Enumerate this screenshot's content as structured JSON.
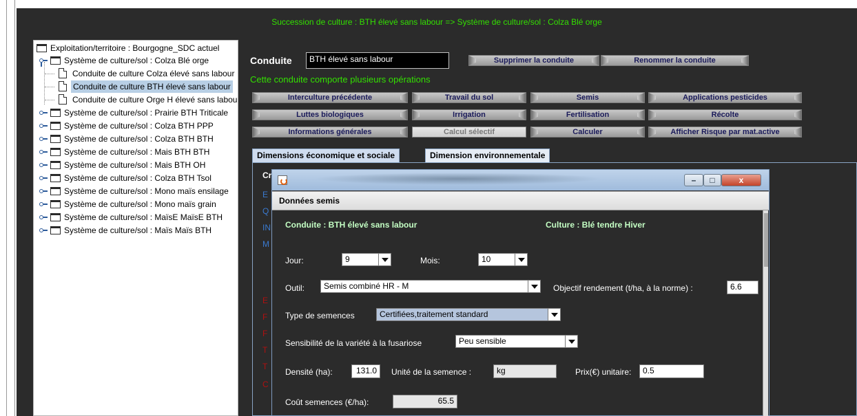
{
  "banner": "Succession de culture : BTH élevé sans labour => Système de culture/sol : Colza Blé orge",
  "tree": {
    "root": "Exploitation/territoire : Bourgogne_SDC actuel",
    "expanded": "Système de culture/sol : Colza Blé orge",
    "children": [
      "Conduite de culture Colza élevé sans labour",
      "Conduite de culture BTH élevé sans labour",
      "Conduite de culture Orge H élevé sans labour"
    ],
    "collapsed": [
      "Système de culture/sol : Prairie BTH Triticale",
      "Système de culture/sol : Colza BTH PPP",
      "Système de culture/sol : Colza BTH BTH",
      "Système de culture/sol : Mais BTH BTH",
      "Système de culture/sol : Mais BTH OH",
      "Système de culture/sol : Colza BTH Tsol",
      "Système de culture/sol : Mono maïs ensilage",
      "Système de culture/sol : Mono maïs grain",
      "Système de culture/sol : MaïsE MaïsE BTH",
      "Système de culture/sol : Maïs Maïs BTH"
    ]
  },
  "conduite": {
    "label": "Conduite",
    "value": "BTH élevé sans labour",
    "delete_btn": "Supprimer la conduite",
    "rename_btn": "Renommer la conduite",
    "info": "Cette conduite comporte plusieurs opérations"
  },
  "ops": {
    "interculture": "Interculture précédente",
    "travail": "Travail du sol",
    "semis": "Semis",
    "pesticides": "Applications pesticides",
    "luttes": "Luttes biologiques",
    "irrigation": "Irrigation",
    "fertilisation": "Fertilisation",
    "recolte": "Récolte",
    "infos": "Informations générales",
    "calcul_sel": "Calcul sélectif",
    "calculer": "Calculer",
    "risque": "Afficher Risque par mat.active"
  },
  "tabs": {
    "eco": "Dimensions économique et sociale",
    "env": "Dimension environnementale"
  },
  "panel_fragments": {
    "a": "Cr",
    "b": "E",
    "c": "Q",
    "d": "IN",
    "e": "M",
    "f": "E",
    "g": "F",
    "h": "F",
    "i": "T",
    "j": "T",
    "k": "C"
  },
  "dialog": {
    "title": "Données semis",
    "conduite": "Conduite : BTH élevé sans labour",
    "culture": "Culture : Blé tendre Hiver",
    "jour_label": "Jour:",
    "jour": "9",
    "mois_label": "Mois:",
    "mois": "10",
    "outil_label": "Outil:",
    "outil": "Semis combiné HR - M",
    "objectif_label": "Objectif rendement (t/ha, à la norme) :",
    "objectif": "6.6",
    "semences_label": "Type de semences",
    "semences": "Certifiées,traitement standard",
    "sensib_label": "Sensibilité de la variété à la fusariose",
    "sensib": "Peu sensible",
    "densite_label": "Densité (ha):",
    "densite": "131.0",
    "unite_label": "Unité de la semence :",
    "unite": "kg",
    "prix_label": "Prix(€) unitaire:",
    "prix": "0.5",
    "cout_label": "Coût semences (€/ha):",
    "cout": "65.5"
  },
  "colors": {
    "accent_green": "#33e000",
    "dark_bg": "#2b2b2b",
    "panel_red": "#b01010",
    "panel_blue": "#3a7ad0"
  }
}
